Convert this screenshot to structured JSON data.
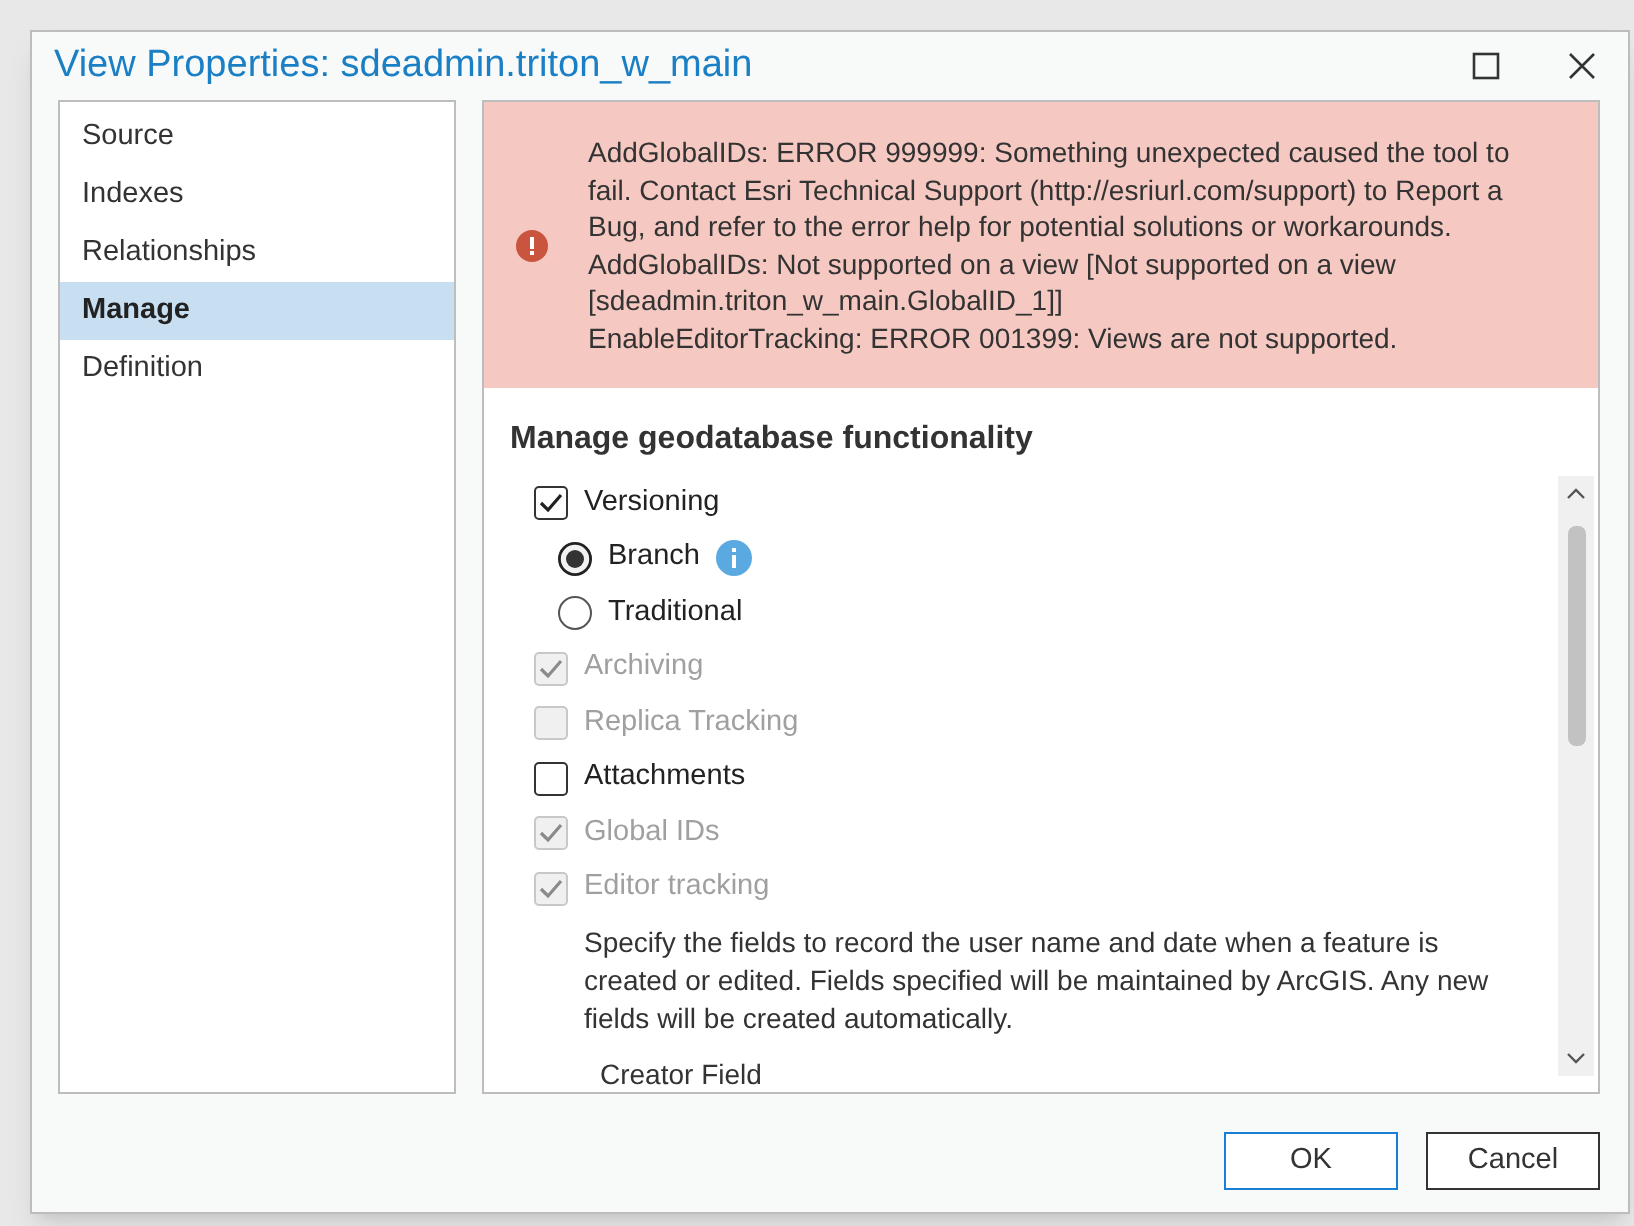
{
  "window": {
    "title": "View Properties: sdeadmin.triton_w_main"
  },
  "sidebar": {
    "items": [
      {
        "label": "Source",
        "selected": false
      },
      {
        "label": "Indexes",
        "selected": false
      },
      {
        "label": "Relationships",
        "selected": false
      },
      {
        "label": "Manage",
        "selected": true
      },
      {
        "label": "Definition",
        "selected": false
      }
    ]
  },
  "error_panel": {
    "lines": [
      "AddGlobalIDs: ERROR 999999: Something unexpected caused the tool to fail. Contact Esri Technical Support (http://esriurl.com/support) to Report a Bug, and refer to the error help for potential solutions or workarounds.",
      "AddGlobalIDs: Not supported on a view [Not supported on a view [sdeadmin.triton_w_main.GlobalID_1]]",
      "EnableEditorTracking: ERROR 001399: Views are not supported."
    ]
  },
  "section": {
    "heading": "Manage geodatabase functionality",
    "options": [
      {
        "kind": "checkbox",
        "label": "Versioning",
        "checked": true,
        "disabled": false,
        "children": [
          {
            "kind": "radio",
            "label": "Branch",
            "selected": true,
            "info": true
          },
          {
            "kind": "radio",
            "label": "Traditional",
            "selected": false
          }
        ]
      },
      {
        "kind": "checkbox",
        "label": "Archiving",
        "checked": true,
        "disabled": true
      },
      {
        "kind": "checkbox",
        "label": "Replica Tracking",
        "checked": false,
        "disabled": true
      },
      {
        "kind": "checkbox",
        "label": "Attachments",
        "checked": false,
        "disabled": false
      },
      {
        "kind": "checkbox",
        "label": "Global IDs",
        "checked": true,
        "disabled": true
      },
      {
        "kind": "checkbox",
        "label": "Editor tracking",
        "checked": true,
        "disabled": true,
        "children": [
          {
            "kind": "note",
            "text": "Specify the fields to record the user name and date when a feature is created or edited. Fields specified will be maintained by ArcGIS. Any new fields will be created automatically."
          },
          {
            "kind": "field_label",
            "text": "Creator Field"
          }
        ]
      }
    ]
  },
  "buttons": [
    {
      "label": "OK",
      "default": true
    },
    {
      "label": "Cancel",
      "default": false
    }
  ]
}
